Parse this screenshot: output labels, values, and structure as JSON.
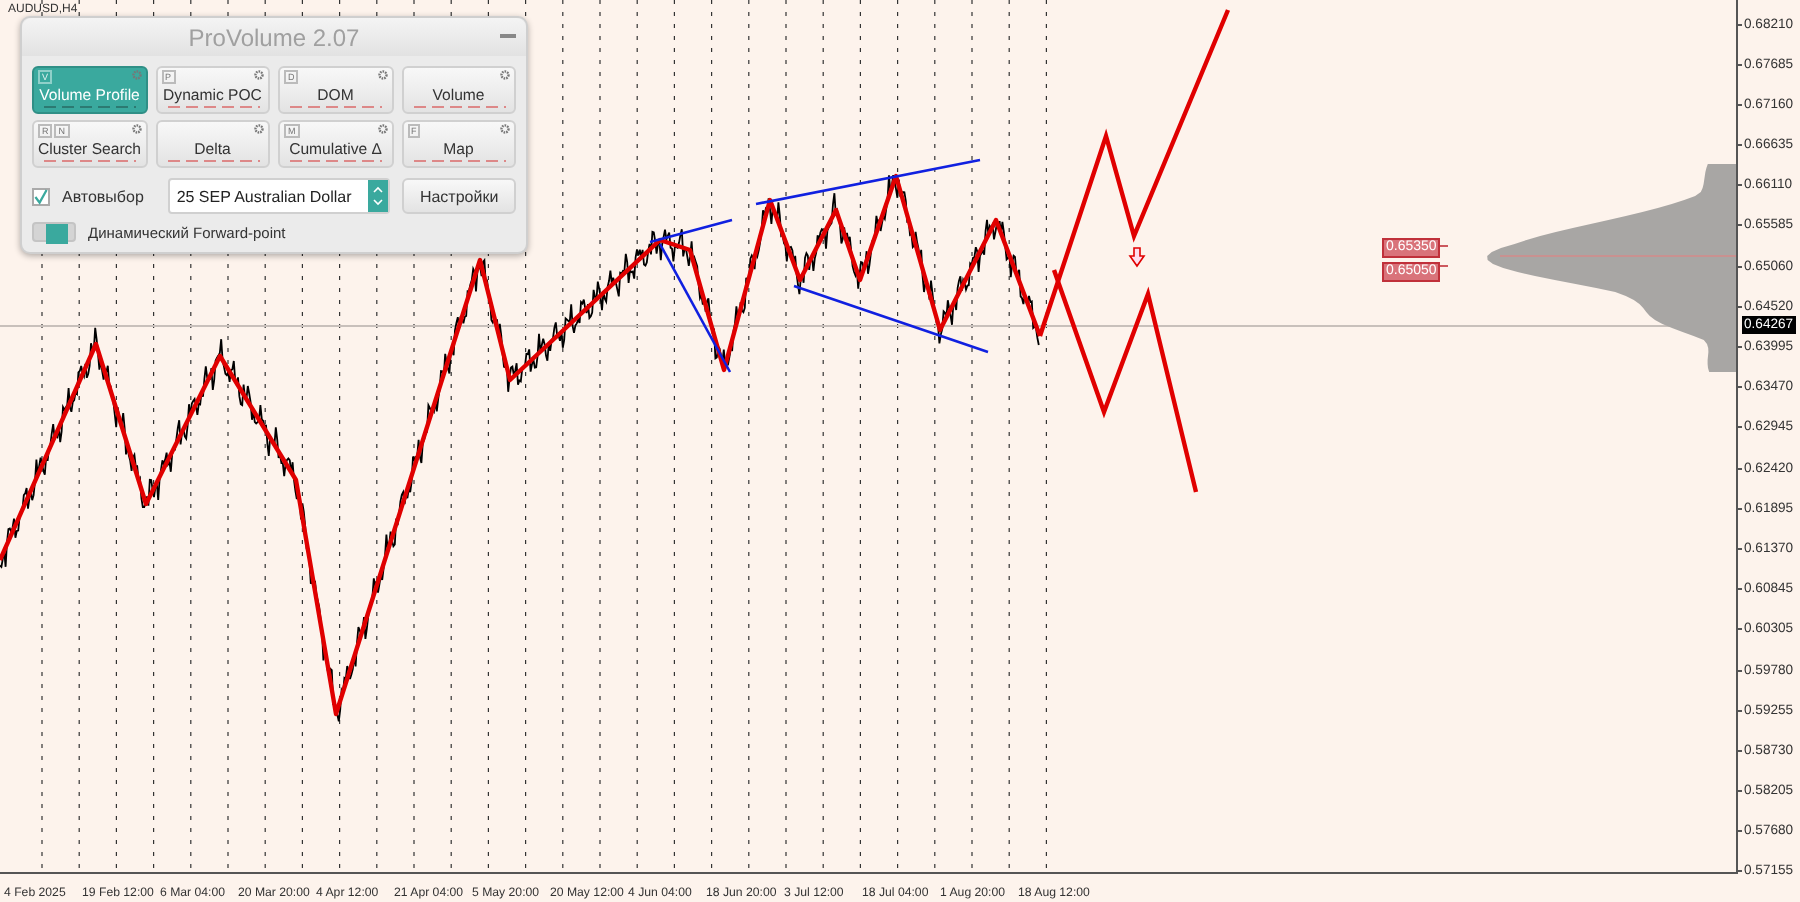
{
  "chart": {
    "symbol": "AUDUSD,H4",
    "price_axis": [
      "0.68210",
      "0.67685",
      "0.67160",
      "0.66635",
      "0.66110",
      "0.65585",
      "0.65060",
      "0.64520",
      "0.63995",
      "0.63470",
      "0.62945",
      "0.62420",
      "0.61895",
      "0.61370",
      "0.60845",
      "0.60305",
      "0.59780",
      "0.59255",
      "0.58730",
      "0.58205",
      "0.57680",
      "0.57155"
    ],
    "current_price": "0.64267",
    "level_tags": [
      "0.65350",
      "0.65050"
    ],
    "time_axis": [
      "4 Feb 2025",
      "19 Feb 12:00",
      "6 Mar 04:00",
      "20 Mar 20:00",
      "4 Apr 12:00",
      "21 Apr 04:00",
      "5 May 20:00",
      "20 May 12:00",
      "4 Jun 04:00",
      "18 Jun 20:00",
      "3 Jul 12:00",
      "18 Jul 04:00",
      "1 Aug 20:00",
      "18 Aug 12:00"
    ]
  },
  "panel": {
    "title": "ProVolume 2.07",
    "buttons": [
      {
        "label": "Volume Profile",
        "hotkeys": [
          "V"
        ],
        "selected": true
      },
      {
        "label": "Dynamic POC",
        "hotkeys": [
          "P"
        ],
        "selected": false
      },
      {
        "label": "DOM",
        "hotkeys": [
          "D"
        ],
        "selected": false
      },
      {
        "label": "Volume",
        "selected": false
      },
      {
        "label": "Cluster Search",
        "hotkeys": [
          "R",
          "N"
        ],
        "selected": false
      },
      {
        "label": "Delta",
        "selected": false
      },
      {
        "label": "Cumulative Δ",
        "hotkeys": [
          "M"
        ],
        "selected": false
      },
      {
        "label": "Map",
        "hotkeys": [
          "F"
        ],
        "selected": false
      }
    ],
    "auto_select": {
      "label": "Автовыбор",
      "checked": true
    },
    "instrument": {
      "value": "25 SEP Australian Dollar"
    },
    "settings_button": "Настройки",
    "forward_point": {
      "label": "Динамический Forward-point",
      "on": true
    }
  }
}
